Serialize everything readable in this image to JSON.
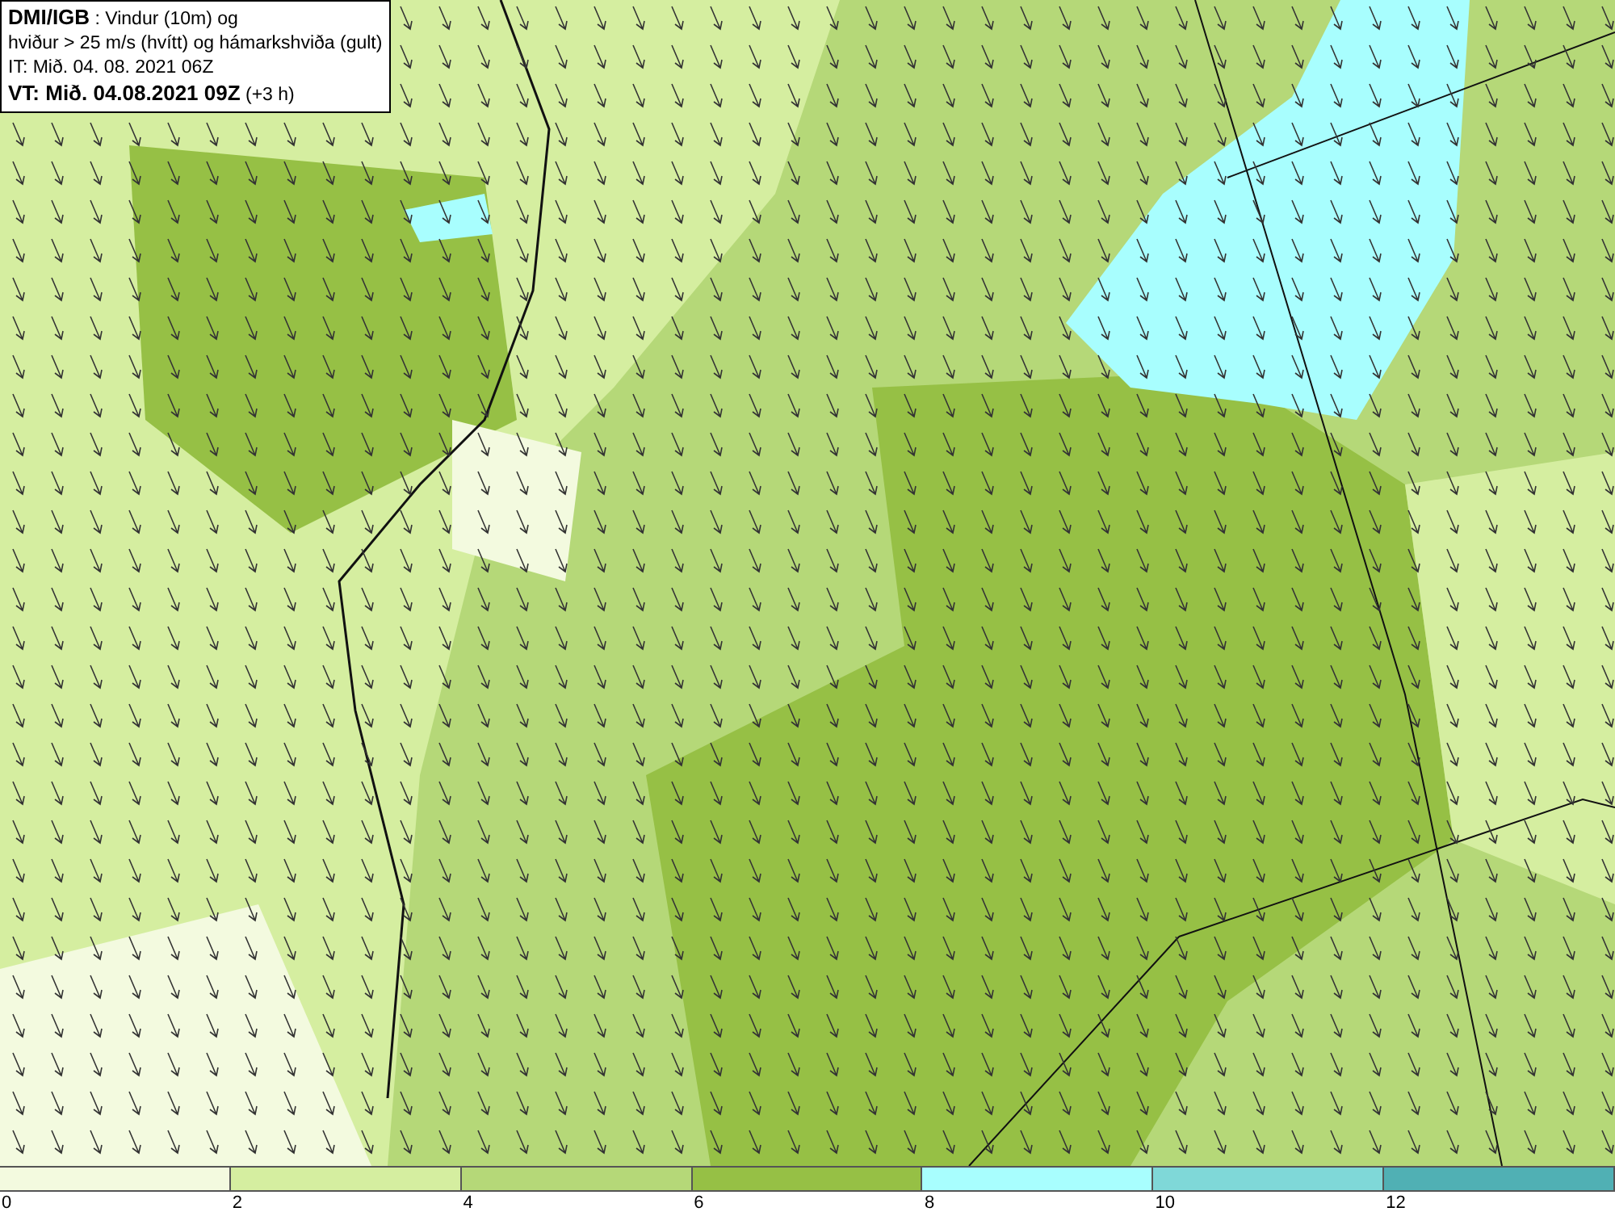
{
  "title_box": {
    "lines": [
      "**DMI/IGB** : Vindur (10m) og",
      "hviður > 25 m/s (hvítt) og hámarkshviða (gult)",
      "IT: Mið. 04. 08. 2021 06Z",
      "**VT: Mið. 04.08.2021 09Z** (+3 h)"
    ]
  },
  "legend": {
    "segments": [
      {
        "color": "#f3fadf"
      },
      {
        "color": "#d5eea0"
      },
      {
        "color": "#b5d878"
      },
      {
        "color": "#96c045"
      },
      {
        "color": "#a8fefe"
      },
      {
        "color": "#7fd8d8"
      },
      {
        "color": "#50b0b4"
      }
    ],
    "ticks": [
      "0",
      "2",
      "4",
      "6",
      "8",
      "10",
      "12"
    ]
  }
}
